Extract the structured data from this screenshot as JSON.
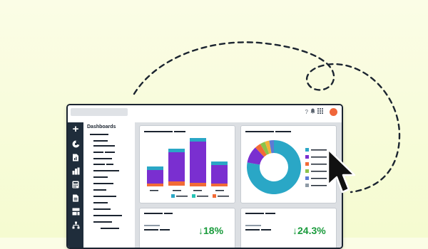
{
  "sidebar": {
    "heading": "Dashboards"
  },
  "metrics": [
    {
      "value": "↓18%"
    },
    {
      "value": "↓24.3%"
    }
  ],
  "colors": {
    "accent_orange": "#f0663a",
    "bar_purple": "#7a2fd0",
    "bar_teal": "#2aa7c6",
    "bar_orange": "#f26b36",
    "positive_green": "#1a9b3c",
    "rail_dark": "#1f2d3b"
  },
  "icons": [
    "plus-icon",
    "chart-icon",
    "document-icon",
    "bar-chart-icon",
    "calculator-icon",
    "document-icon",
    "dashboard-icon",
    "hierarchy-icon",
    "cursor-icon"
  ]
}
